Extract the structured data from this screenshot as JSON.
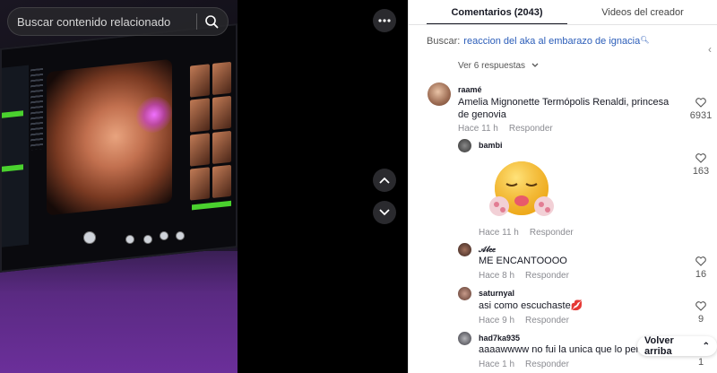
{
  "video": {
    "search_placeholder": "Buscar contenido relacionado",
    "more_icon": "more-horizontal-icon",
    "up_icon": "chevron-up-icon",
    "down_icon": "chevron-down-icon"
  },
  "tabs": [
    {
      "label": "Comentarios (2043)",
      "active": true
    },
    {
      "label": "Videos del creador",
      "active": false
    }
  ],
  "search_suggestion": {
    "prefix": "Buscar:",
    "query": "reaccion del aka al embarazo de ignacia"
  },
  "replies_toggle": "Ver 6 respuestas",
  "comments": [
    {
      "username": "raamé",
      "text": "Amelia Mignonette Termópolis Renaldi, princesa de genovia",
      "time": "Hace 11 h",
      "reply": "Responder",
      "likes": "6931"
    },
    {
      "username": "bambi",
      "text": "",
      "time": "Hace 11 h",
      "reply": "Responder",
      "likes": "163"
    },
    {
      "username": "𝒜𝓁𝑒𝑒",
      "text": "ME ENCANTOOOO",
      "time": "Hace 8 h",
      "reply": "Responder",
      "likes": "16"
    },
    {
      "username": "saturnyal",
      "text": "asi como escuchaste💋",
      "time": "Hace 9 h",
      "reply": "Responder",
      "likes": "9"
    },
    {
      "username": "had7ka935",
      "text": "aaaawwww no fui la unica que lo pen",
      "time": "Hace 1 h",
      "reply": "Responder",
      "likes": "1"
    }
  ],
  "back_to_top": "Volver arriba",
  "colors": {
    "link_blue": "#2b5db9",
    "text_dark": "#161823",
    "meta_gray": "#8a8b91"
  }
}
